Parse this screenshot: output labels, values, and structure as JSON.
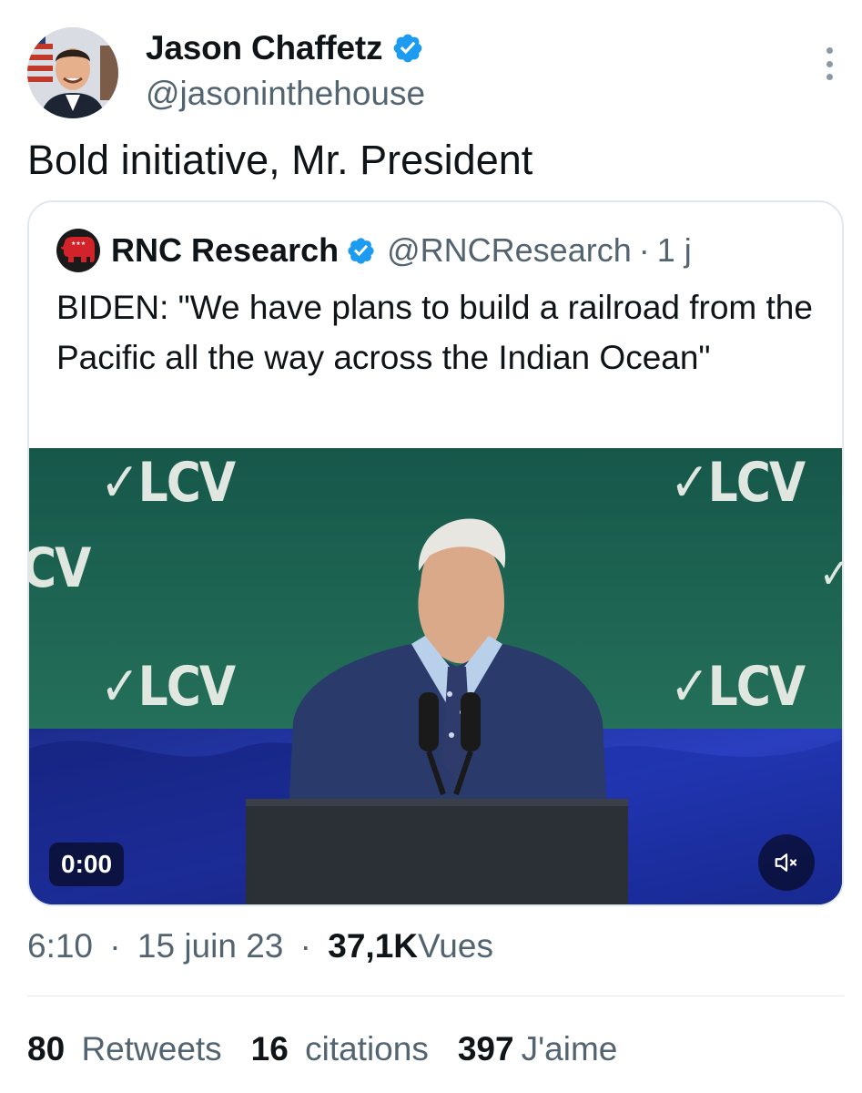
{
  "tweet": {
    "author": {
      "name": "Jason Chaffetz",
      "handle": "@jasoninthehouse"
    },
    "text": "Bold initiative, Mr. President",
    "quote": {
      "name": "RNC Research",
      "handle": "@RNCResearch",
      "separator": "·",
      "age": "1 j",
      "text": "BIDEN: \"We have plans to build a railroad from the Pacific all the way across the Indian Ocean\"",
      "video": {
        "time": "0:00",
        "banner_text": "✓LCV",
        "banner_partial_left": "CV",
        "banner_partial_right": "✓"
      }
    },
    "meta": {
      "time": "6:10",
      "sep1": "·",
      "date": "15 juin 23",
      "sep2": "·",
      "views": "37,1K",
      "views_label": "Vues"
    },
    "stats": {
      "retweets": "80",
      "retweets_label": "Retweets",
      "quotes": "16",
      "quotes_label": "citations",
      "likes": "397",
      "likes_label": "J'aime"
    }
  },
  "icons": {
    "verified": "verified-badge-icon",
    "more": "more-vertical-icon",
    "mute": "volume-muted-icon",
    "rnc_logo": "gop-elephant-icon"
  },
  "colors": {
    "verified_blue": "#1d9bf0",
    "secondary_text": "#536471",
    "primary_text": "#0f1419",
    "stage_green": "#1d5e4b",
    "stage_blue": "#1a2fa0"
  }
}
